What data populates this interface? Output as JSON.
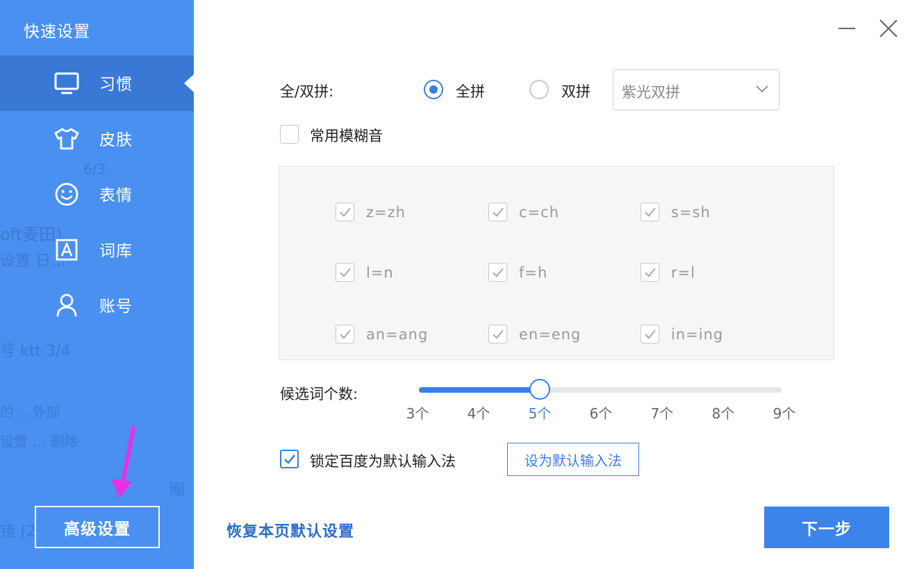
{
  "sidebar": {
    "title": "快速设置",
    "items": [
      {
        "label": "习惯",
        "icon": "monitor-icon",
        "active": true
      },
      {
        "label": "皮肤",
        "icon": "tshirt-icon",
        "active": false
      },
      {
        "label": "表情",
        "icon": "smiley-icon",
        "active": false
      },
      {
        "label": "词库",
        "icon": "letter-a-icon",
        "active": false
      },
      {
        "label": "账号",
        "icon": "user-icon",
        "active": false
      }
    ],
    "background_ghost_text": [
      "6/3",
      "oft麦田)",
      "设置 日…",
      "号 ktt 3/4",
      "的… 外部",
      "设置 … 删除",
      "圈",
      "错 (2"
    ],
    "advanced_button": "高级设置"
  },
  "window": {
    "minimize_icon": "minimize-icon",
    "close_icon": "close-icon"
  },
  "pinyin": {
    "label": "全/双拼:",
    "options": [
      {
        "label": "全拼",
        "selected": true
      },
      {
        "label": "双拼",
        "selected": false
      }
    ],
    "scheme_select": {
      "value": "紫光双拼"
    }
  },
  "fuzzy": {
    "label": "常用模糊音",
    "checked": false,
    "items": [
      {
        "label": "z=zh",
        "checked": true
      },
      {
        "label": "c=ch",
        "checked": true
      },
      {
        "label": "s=sh",
        "checked": true
      },
      {
        "label": "l=n",
        "checked": true
      },
      {
        "label": "f=h",
        "checked": true
      },
      {
        "label": "r=l",
        "checked": true
      },
      {
        "label": "an=ang",
        "checked": true
      },
      {
        "label": "en=eng",
        "checked": true
      },
      {
        "label": "in=ing",
        "checked": true
      }
    ]
  },
  "candidates": {
    "label": "候选词个数:",
    "ticks": [
      "3个",
      "4个",
      "5个",
      "6个",
      "7个",
      "8个",
      "9个"
    ],
    "min": 3,
    "max": 9,
    "value": 5
  },
  "lock_default": {
    "label": "锁定百度为默认输入法",
    "checked": true
  },
  "set_default_button": "设为默认输入法",
  "restore_link": "恢复本页默认设置",
  "next_button": "下一步",
  "colors": {
    "sidebar": "#4a90f0",
    "sidebar_active": "#3a78d6",
    "accent": "#3a7fe0",
    "next_button": "#3a84ea"
  }
}
